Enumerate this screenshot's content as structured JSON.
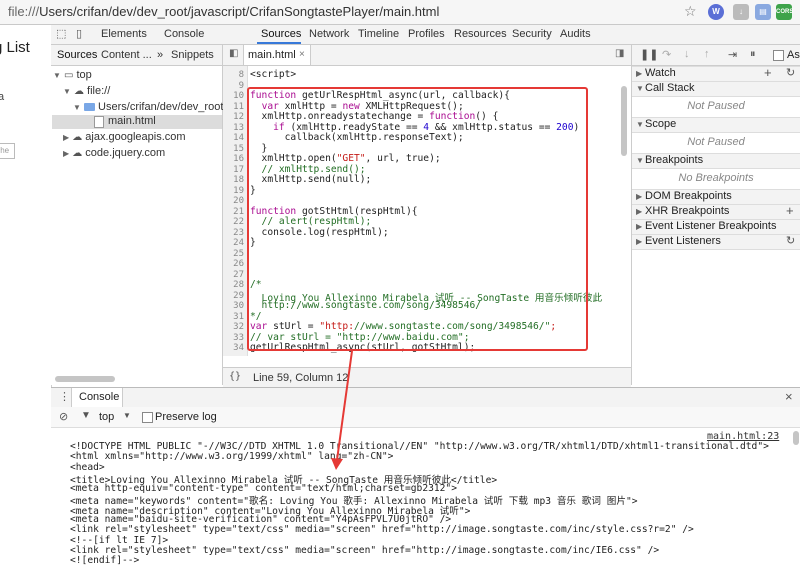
{
  "browser": {
    "url_prefix": "file:///",
    "url_path": "Users/crifan/dev/dev_root/javascript/CrifanSongtastePlayer/main.html",
    "ext_label": "CORS"
  },
  "page": {
    "title_fragment": "g List",
    "small_char": "a",
    "input_placeholder": "s he"
  },
  "devtools": {
    "tabs": [
      "Elements",
      "Console",
      "Sources",
      "Network",
      "Timeline",
      "Profiles",
      "Resources",
      "Security",
      "Audits"
    ],
    "active_tab": "Sources"
  },
  "navigator": {
    "tabs": [
      "Sources",
      "Content ...",
      "Snippets"
    ],
    "tree": {
      "top": "top",
      "file": "file://",
      "folder": "Users/crifan/dev/dev_root/",
      "selected_file": "main.html",
      "domain1": "ajax.googleapis.com",
      "domain2": "code.jquery.com"
    }
  },
  "editor": {
    "tab": "main.html",
    "line_numbers": [
      "8",
      "9",
      "10",
      "11",
      "12",
      "13",
      "14",
      "15",
      "16",
      "17",
      "18",
      "19",
      "20",
      "21",
      "22",
      "23",
      "24",
      "25",
      "26",
      "27",
      "28",
      "29",
      "30",
      "31",
      "32",
      "33",
      "34"
    ],
    "lines": [
      "<script>",
      "",
      "function getUrlRespHtml_async(url, callback){",
      "  var xmlHttp = new XMLHttpRequest();",
      "  xmlHttp.onreadystatechange = function() {",
      "    if (xmlHttp.readyState == 4 && xmlHttp.status == 200)",
      "      callback(xmlHttp.responseText);",
      "  }",
      "  xmlHttp.open(\"GET\", url, true);",
      "  // xmlHttp.send();",
      "  xmlHttp.send(null);",
      "}",
      "",
      "function gotStHtml(respHtml){",
      "  // alert(respHtml);",
      "  console.log(respHtml);",
      "}",
      "",
      "",
      "",
      "/*",
      "  Loving You Allexinno Mirabela 试听 -- SongTaste 用音乐倾听彼此",
      "  http://www.songtaste.com/song/3498546/",
      "*/",
      "var stUrl = \"http://www.songtaste.com/song/3498546/\";",
      "// var stUrl = \"http://www.baidu.com\";",
      "getUrlRespHtml_async(stUrl, gotStHtml);"
    ],
    "status": "Line 59, Column 12",
    "status_icon": "{}"
  },
  "sidebar": {
    "sections": [
      {
        "label": "Watch",
        "expanded": true,
        "empty": ""
      },
      {
        "label": "Call Stack",
        "expanded": true,
        "empty": "Not Paused"
      },
      {
        "label": "Scope",
        "expanded": true,
        "empty": "Not Paused"
      },
      {
        "label": "Breakpoints",
        "expanded": true,
        "empty": "No Breakpoints"
      },
      {
        "label": "DOM Breakpoints",
        "expanded": false,
        "empty": ""
      },
      {
        "label": "XHR Breakpoints",
        "expanded": false,
        "empty": ""
      },
      {
        "label": "Event Listener Breakpoints",
        "expanded": false,
        "empty": ""
      },
      {
        "label": "Event Listeners",
        "expanded": false,
        "empty": ""
      }
    ],
    "async_label": "As"
  },
  "drawer": {
    "tab": "Console",
    "context": "top",
    "preserve_log": "Preserve log",
    "source_link": "main.html:23",
    "lines": [
      "<!DOCTYPE HTML PUBLIC \"-//W3C//DTD XHTML 1.0 Transitional//EN\" \"http://www.w3.org/TR/xhtml1/DTD/xhtml1-transitional.dtd\">",
      "<html xmlns=\"http://www.w3.org/1999/xhtml\" lang=\"zh-CN\">",
      "<head>",
      "<title>Loving You Allexinno Mirabela 试听 -- SongTaste 用音乐倾听彼此</title>",
      "<meta http-equiv=\"content-type\" content=\"text/html;charset=gb2312\">",
      "<meta name=\"keywords\" content=\"歌名: Loving You 歌手: Allexinno Mirabela 试听 下载 mp3 音乐 歌词 图片\">",
      "<meta name=\"description\" content=\"Loving You Allexinno Mirabela 试听\">",
      "<meta name=\"baidu-site-verification\" content=\"Y4pAsFPVL7U0jtRO\" />",
      "<link rel=\"stylesheet\" type=\"text/css\" media=\"screen\" href=\"http://image.songtaste.com/inc/style.css?r=2\" />",
      "<!--[if lt IE 7]>",
      "<link rel=\"stylesheet\" type=\"text/css\" media=\"screen\" href=\"http://image.songtaste.com/inc/IE6.css\" />",
      "<![endif]-->"
    ]
  },
  "colors": {
    "annotation": "#e53935",
    "active_tab_underline": "#3879d9"
  }
}
